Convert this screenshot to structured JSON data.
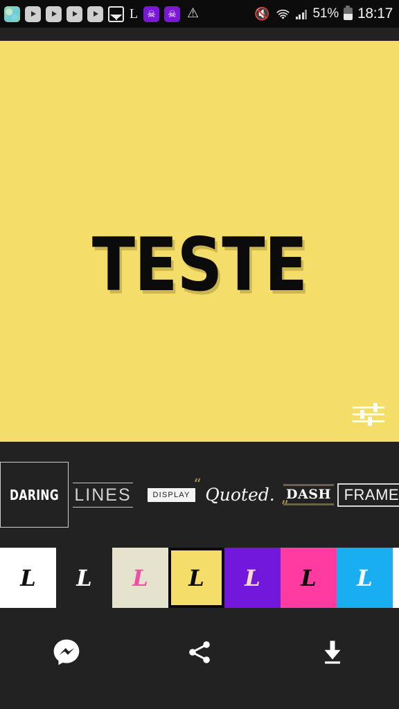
{
  "statusbar": {
    "left_icons": [
      {
        "name": "app-icon",
        "label": ""
      },
      {
        "name": "youtube-icon-1",
        "label": ""
      },
      {
        "name": "youtube-icon-2",
        "label": ""
      },
      {
        "name": "youtube-icon-3",
        "label": ""
      },
      {
        "name": "youtube-icon-4",
        "label": ""
      },
      {
        "name": "photo-icon",
        "label": ""
      },
      {
        "name": "letter-l-icon",
        "label": "L"
      },
      {
        "name": "skull-icon-1",
        "label": "☠"
      },
      {
        "name": "skull-icon-2",
        "label": "☠"
      },
      {
        "name": "warning-icon",
        "label": "⚠"
      }
    ],
    "mute_icon": "🔇",
    "wifi_icon": "wifi-icon",
    "signal_icon": "signal-icon",
    "battery_percent": "51%",
    "battery_icon": "battery-icon",
    "time": "18:17"
  },
  "canvas": {
    "text": "TESTE",
    "background_color": "#f4dd68",
    "text_color": "#0b0b0b",
    "tune_button": "tune-icon"
  },
  "styles": {
    "items": [
      {
        "id": "daring",
        "label": "DARING",
        "selected": true
      },
      {
        "id": "lines",
        "label": "LINES",
        "selected": false
      },
      {
        "id": "display",
        "label": "DISPLAY",
        "selected": false
      },
      {
        "id": "quoted",
        "label": "Quoted.",
        "quote_open": "“",
        "quote_close": "”",
        "selected": false
      },
      {
        "id": "dash",
        "label": "DASH",
        "selected": false
      },
      {
        "id": "framed",
        "label": "FRAMED",
        "selected": false
      }
    ]
  },
  "swatches": {
    "glyph": "L",
    "items": [
      {
        "id": "white",
        "bg": "#ffffff",
        "fg": "#111111",
        "selected": false
      },
      {
        "id": "dark",
        "bg": "#222222",
        "fg": "#ffffff",
        "selected": false
      },
      {
        "id": "cream",
        "bg": "#e5e2cd",
        "fg": "#ef4fa4",
        "selected": false
      },
      {
        "id": "yellow",
        "bg": "#f4dd68",
        "fg": "#0a0a0a",
        "selected": true
      },
      {
        "id": "purple",
        "bg": "#7218dc",
        "fg": "#fadcc0",
        "selected": false
      },
      {
        "id": "pink",
        "bg": "#ff3aa0",
        "fg": "#0a0a0a",
        "selected": false
      },
      {
        "id": "cyan",
        "bg": "#19aef0",
        "fg": "#f6fdff",
        "selected": false
      }
    ]
  },
  "bottombar": {
    "buttons": [
      {
        "id": "messenger",
        "name": "messenger-share-button"
      },
      {
        "id": "share",
        "name": "share-button"
      },
      {
        "id": "download",
        "name": "download-button"
      }
    ]
  }
}
